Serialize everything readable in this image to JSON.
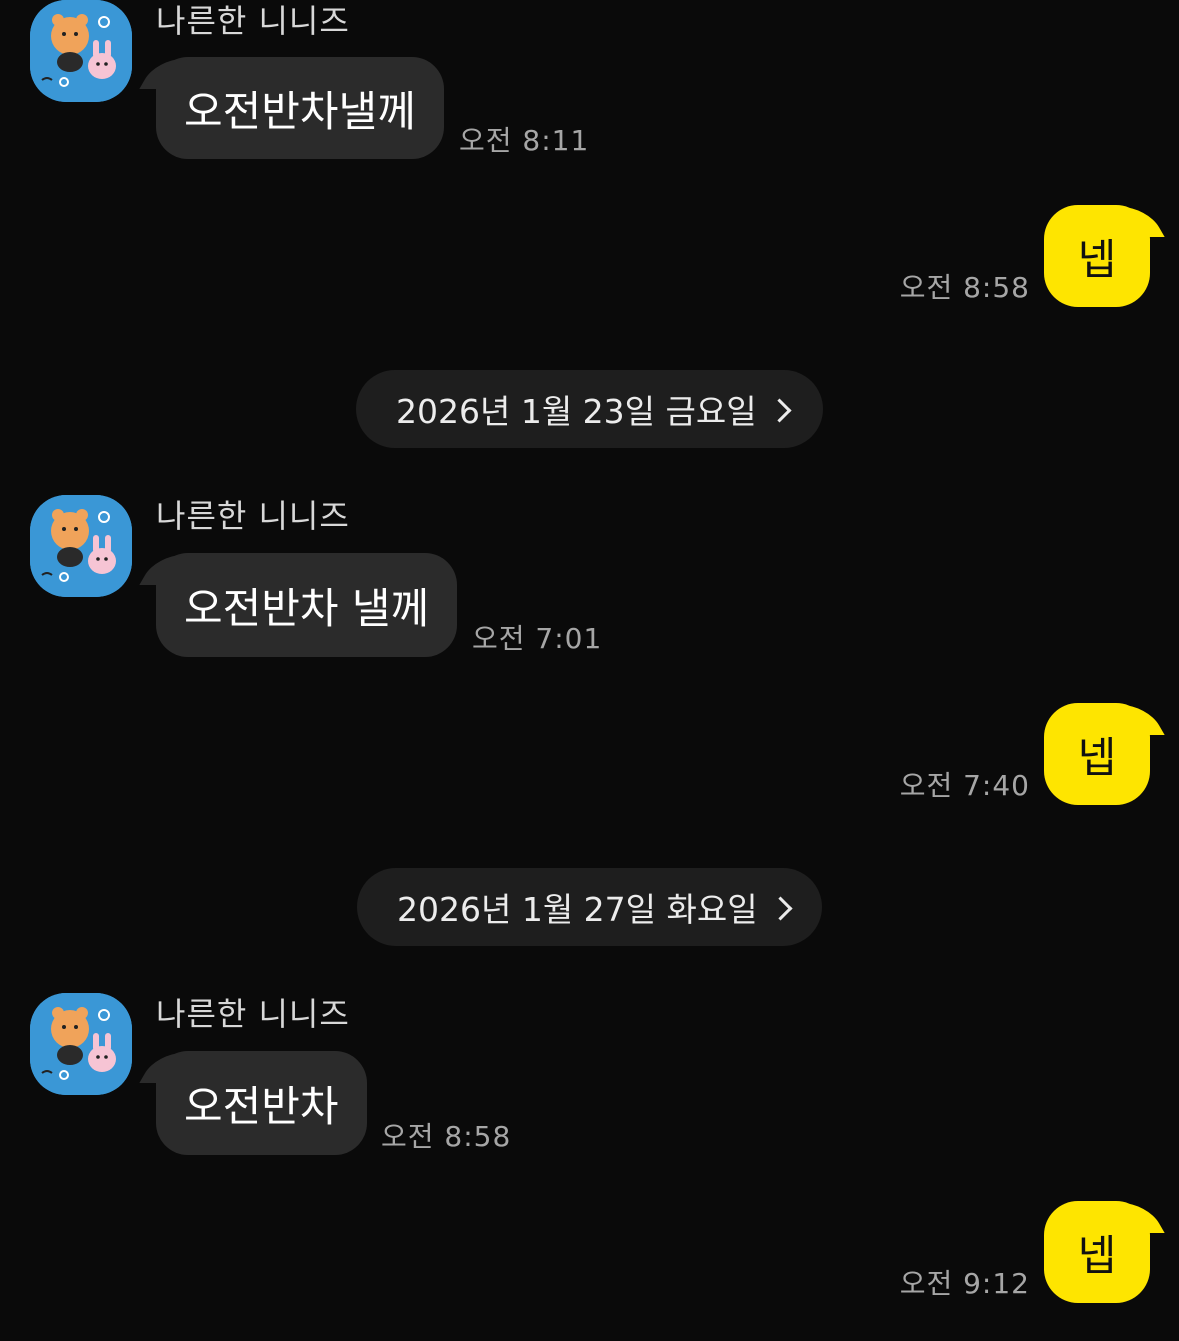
{
  "sender_name": "나른한 니니즈",
  "groups": [
    {
      "incoming": {
        "text": "오전반차낼께",
        "time": "오전 8:11"
      },
      "outgoing": {
        "text": "넵",
        "time": "오전 8:58"
      }
    },
    {
      "date": "2026년 1월 23일 금요일",
      "incoming": {
        "text": "오전반차 낼께",
        "time": "오전 7:01"
      },
      "outgoing": {
        "text": "넵",
        "time": "오전 7:40"
      }
    },
    {
      "date": "2026년 1월 27일 화요일",
      "incoming": {
        "text": "오전반차",
        "time": "오전 8:58"
      },
      "outgoing": {
        "text": "넵",
        "time": "오전 9:12"
      }
    }
  ],
  "icons": {
    "avatar": "ninimz-sticker-avatar",
    "date_chevron": "chevron-right-icon"
  },
  "colors": {
    "background": "#0a0a0a",
    "incoming_bubble": "#2b2b2b",
    "outgoing_bubble": "#fee500",
    "date_pill": "#1e1e1e",
    "time_text": "#a6a6a6"
  }
}
